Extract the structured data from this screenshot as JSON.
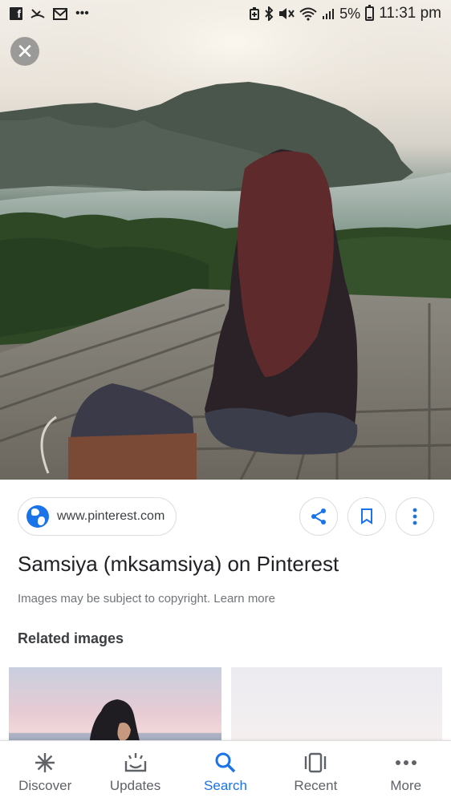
{
  "status_bar": {
    "time": "11:31 pm",
    "battery": "5%",
    "left_icons": [
      "facebook-icon",
      "missed-call-icon",
      "gmail-icon",
      "more-notifications-icon"
    ],
    "right_icons": [
      "battery-saver-icon",
      "bluetooth-icon",
      "mute-icon",
      "wifi-icon",
      "signal-icon",
      "battery-icon"
    ]
  },
  "viewer": {
    "close_icon": "close-icon"
  },
  "result": {
    "source": "www.pinterest.com",
    "title": "Samsiya (mksamsiya) on Pinterest",
    "copyright_note": "Images may be subject to copyright. Learn more",
    "actions": [
      "share-icon",
      "bookmark-icon",
      "more-vert-icon"
    ]
  },
  "related": {
    "heading": "Related images"
  },
  "bottom_nav": {
    "items": [
      {
        "label": "Discover",
        "icon": "asterisk-icon"
      },
      {
        "label": "Updates",
        "icon": "updates-icon"
      },
      {
        "label": "Search",
        "icon": "search-icon"
      },
      {
        "label": "Recent",
        "icon": "recent-icon"
      },
      {
        "label": "More",
        "icon": "more-horiz-icon"
      }
    ],
    "active": "Search"
  },
  "colors": {
    "accent": "#1a73e8",
    "text_primary": "#202124",
    "text_secondary": "#70757a"
  }
}
